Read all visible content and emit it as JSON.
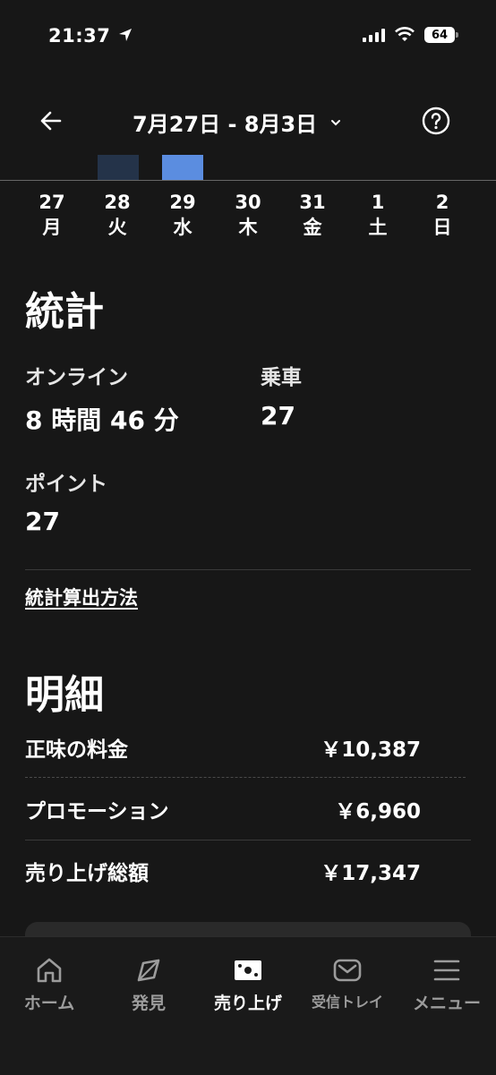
{
  "status": {
    "time": "21:37",
    "battery": "64"
  },
  "header": {
    "date_range": "7月27日 - 8月3日"
  },
  "week": {
    "days": [
      {
        "num": "27",
        "wd": "月"
      },
      {
        "num": "28",
        "wd": "火"
      },
      {
        "num": "29",
        "wd": "水"
      },
      {
        "num": "30",
        "wd": "木"
      },
      {
        "num": "31",
        "wd": "金"
      },
      {
        "num": "1",
        "wd": "土"
      },
      {
        "num": "2",
        "wd": "日"
      }
    ],
    "bar_colors": {
      "day28": "#243349",
      "day29": "#5b8de0"
    }
  },
  "stats": {
    "title": "統計",
    "online_label": "オンライン",
    "online_value": "8 時間 46 分",
    "rides_label": "乗車",
    "rides_value": "27",
    "points_label": "ポイント",
    "points_value": "27",
    "calc_link": "統計算出方法"
  },
  "breakdown": {
    "title": "明細",
    "rows": [
      {
        "label": "正味の料金",
        "value": "￥10,387"
      },
      {
        "label": "プロモーション",
        "value": "￥6,960"
      },
      {
        "label": "売り上げ総額",
        "value": "￥17,347"
      }
    ]
  },
  "tabs": [
    {
      "label": "ホーム",
      "icon": "home-icon"
    },
    {
      "label": "発見",
      "icon": "compass-icon"
    },
    {
      "label": "売り上げ",
      "icon": "money-icon"
    },
    {
      "label": "受信トレイ",
      "icon": "mail-icon"
    },
    {
      "label": "メニュー",
      "icon": "menu-icon"
    }
  ]
}
